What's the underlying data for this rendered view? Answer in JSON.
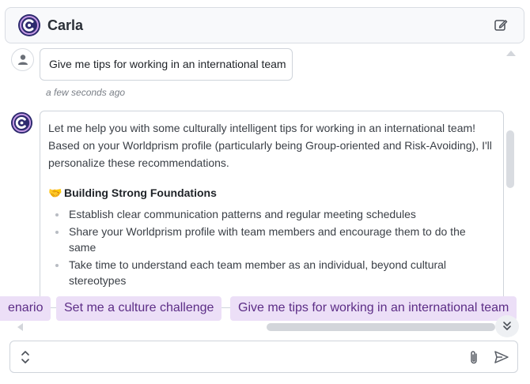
{
  "header": {
    "name": "Carla"
  },
  "user_message": {
    "text": "Give me tips for working in an international team",
    "timestamp": "a few seconds ago"
  },
  "bot_message": {
    "intro": "Let me help you with some culturally intelligent tips for working in an international team! Based on your Worldprism profile (particularly being Group-oriented and Risk-Avoiding), I'll personalize these recommendations.",
    "section_emoji": "🤝",
    "section_title": "Building Strong Foundations",
    "items": [
      "Establish clear communication patterns and regular meeting schedules",
      "Share your Worldprism profile with team members and encourage them to do the same",
      "Take time to understand each team member as an individual, beyond cultural stereotypes"
    ]
  },
  "suggestions": [
    "enario",
    "Set me a culture challenge",
    "Give me tips for working in an international team"
  ],
  "composer": {
    "placeholder": ""
  },
  "colors": {
    "accent": "#5c2d86",
    "chip_bg": "#ecdff7",
    "logo_dark": "#2d2a6e"
  }
}
